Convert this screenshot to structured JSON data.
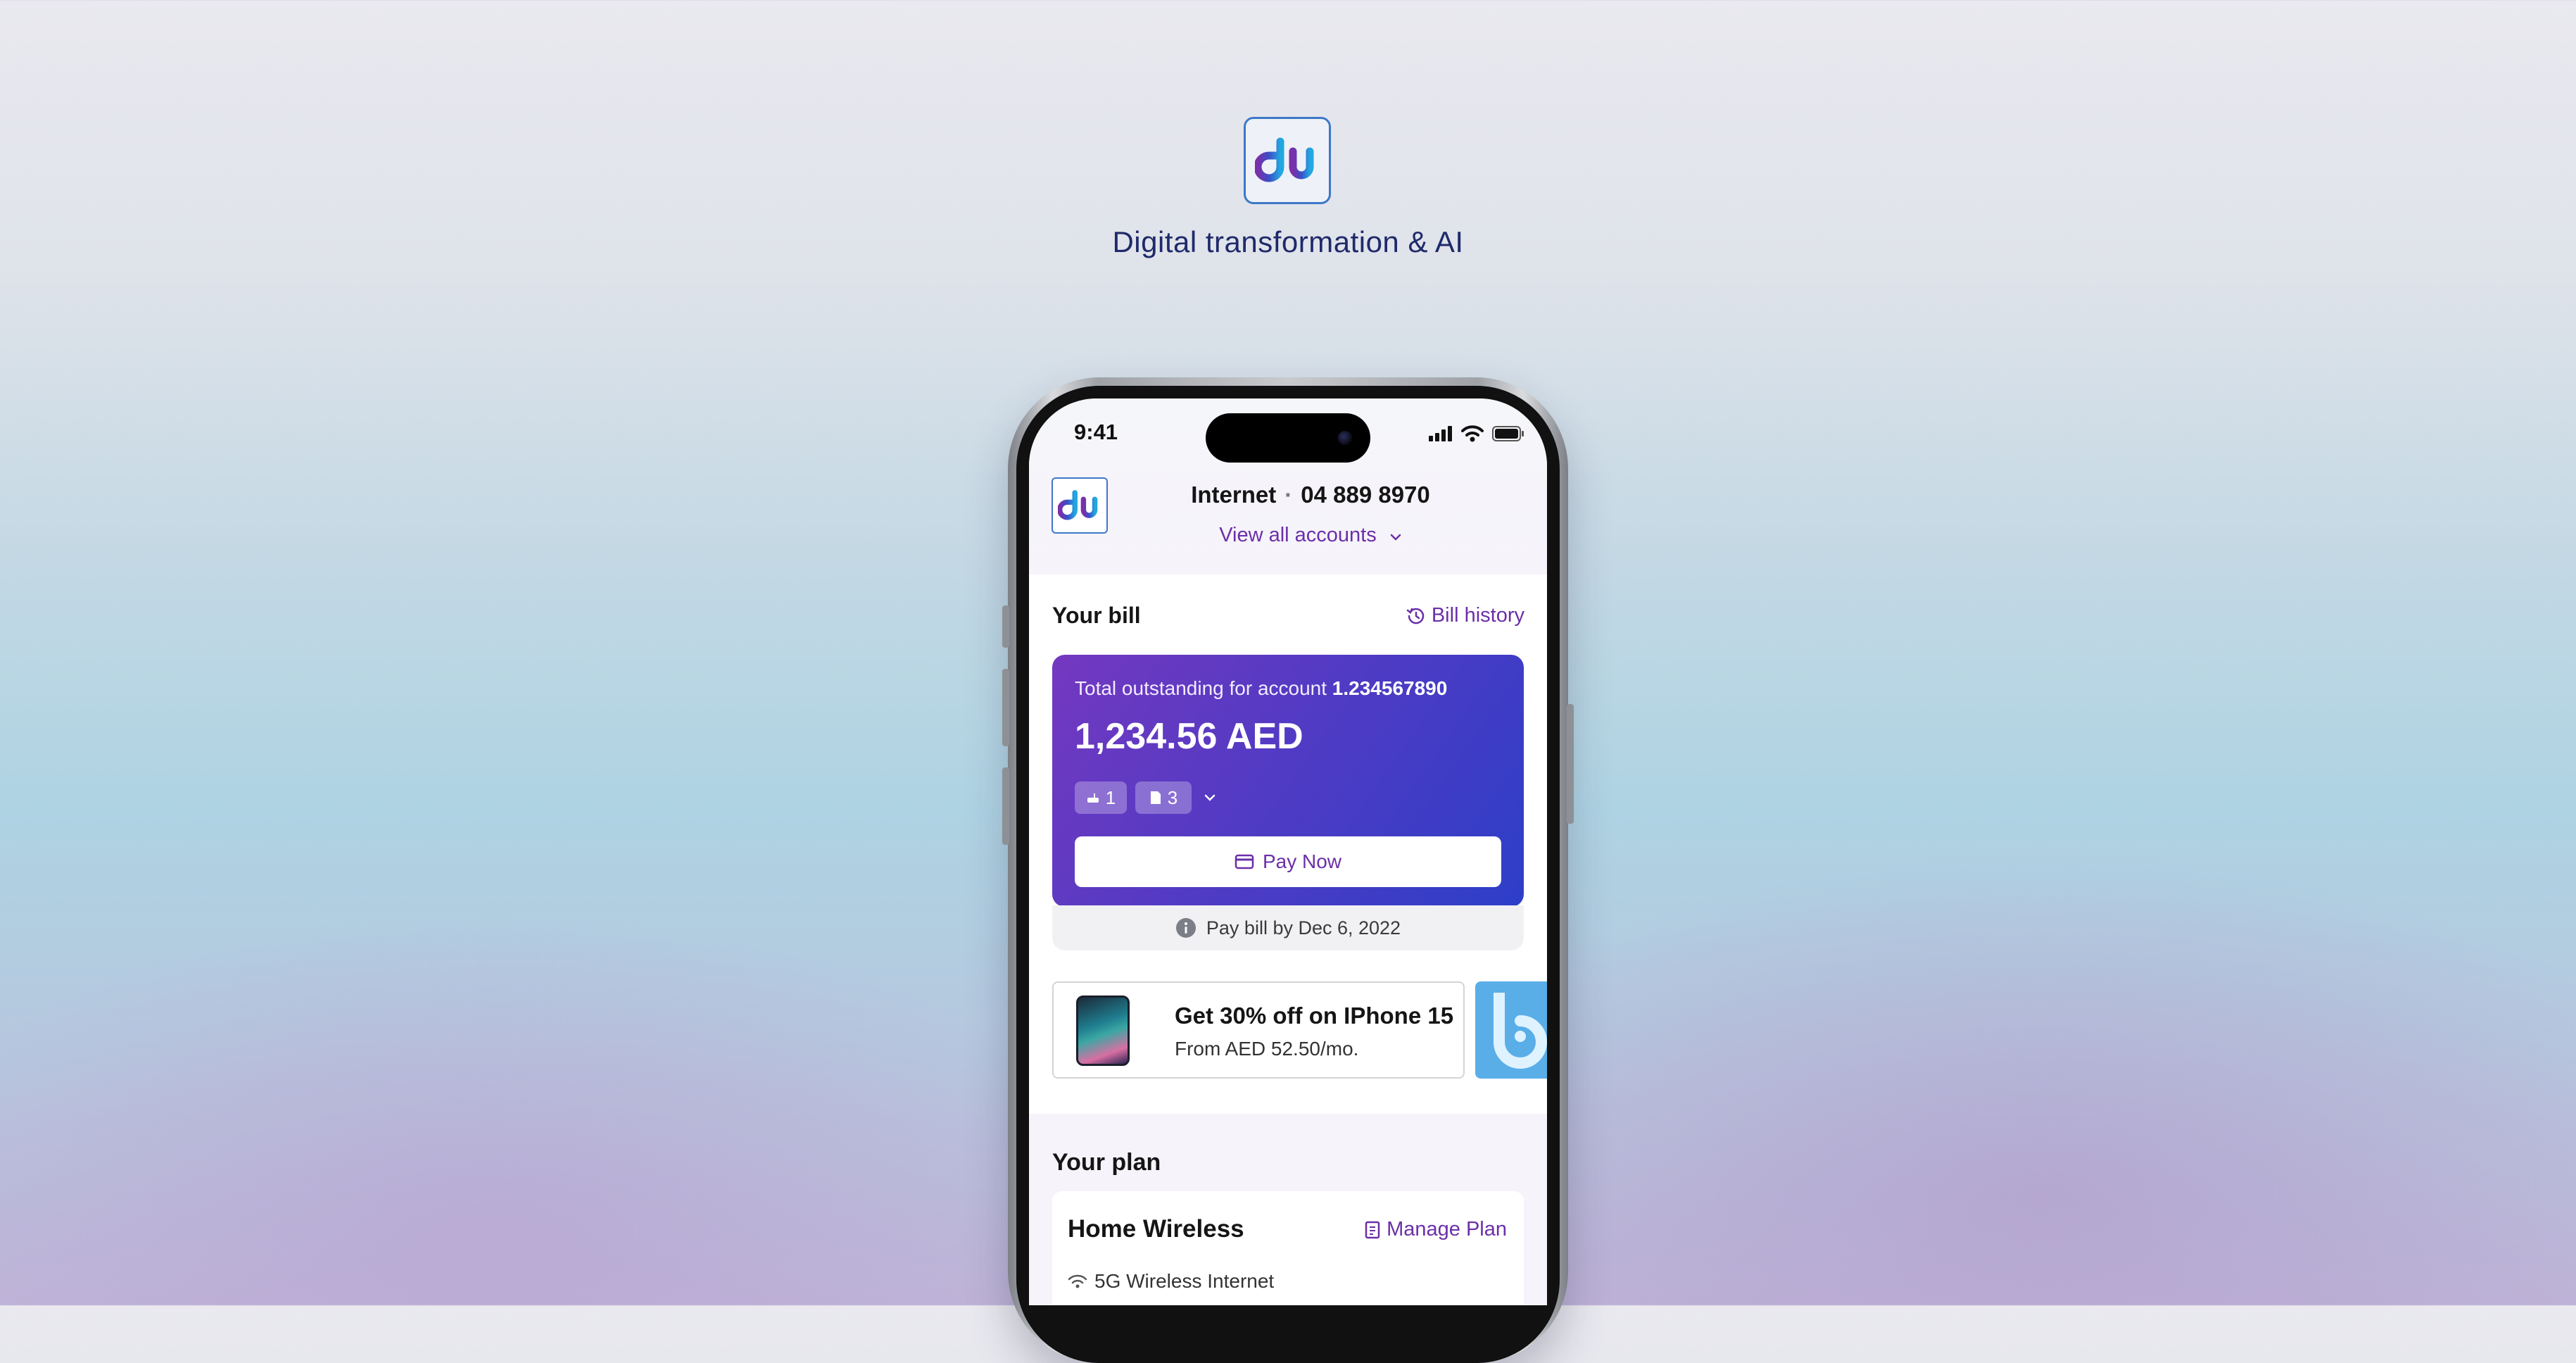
{
  "brand": {
    "tagline": "Digital transformation & AI",
    "logo_icon": "du-logo",
    "accent_color": "#6b2fa8"
  },
  "status_bar": {
    "time": "9:41"
  },
  "header": {
    "service": "Internet",
    "number": "04 889 8970",
    "view_all": "View all accounts"
  },
  "bill": {
    "section_title": "Your bill",
    "history_link": "Bill history",
    "outstanding_label": "Total outstanding for account",
    "account_number": "1.234567890",
    "amount": "1,234.56 AED",
    "chip_router_count": "1",
    "chip_sim_count": "3",
    "pay_button": "Pay Now",
    "due_text": "Pay bill by Dec 6, 2022"
  },
  "promo": {
    "title": "Get 30% off on IPhone 15",
    "subtitle": "From AED 52.50/mo."
  },
  "plan": {
    "section_title": "Your plan",
    "name": "Home Wireless",
    "manage_link": "Manage Plan",
    "feature": "5G Wireless Internet"
  }
}
